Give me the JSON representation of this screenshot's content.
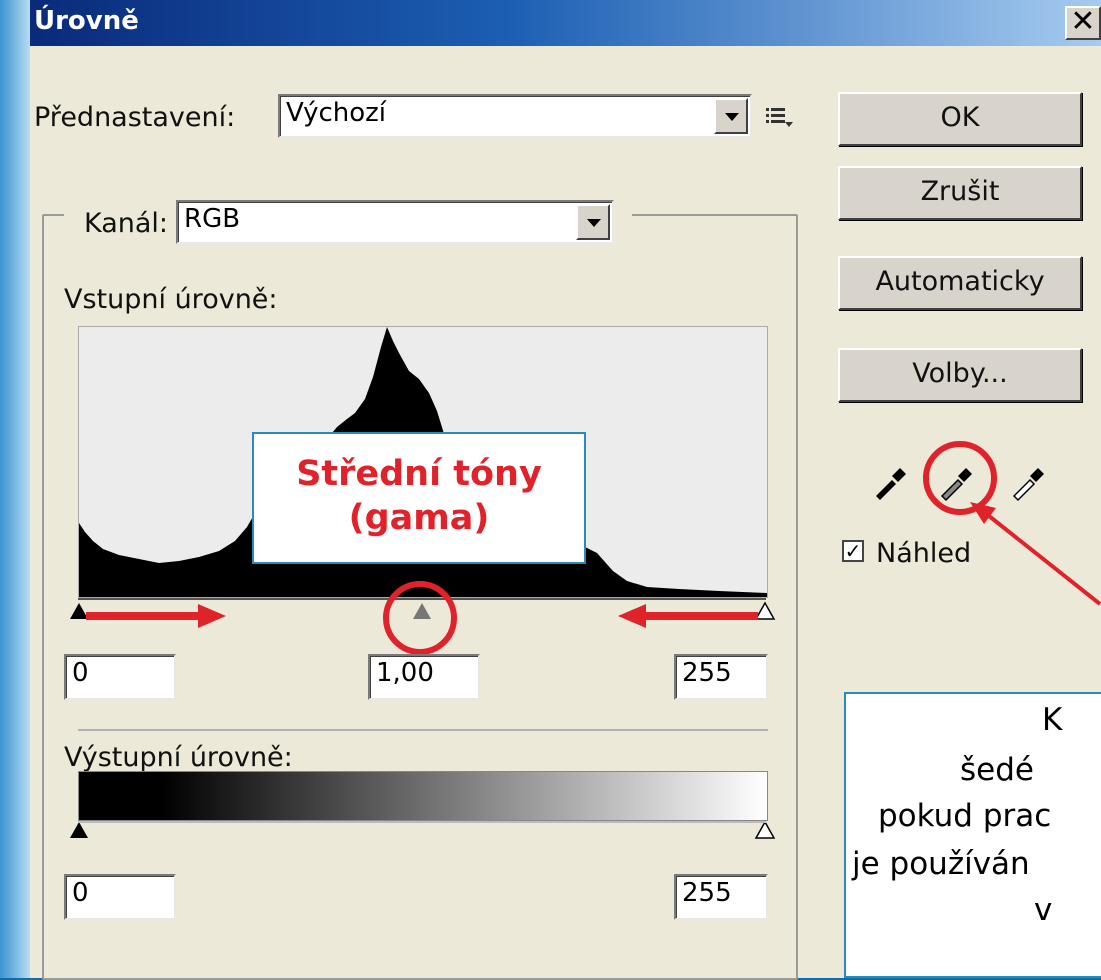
{
  "window": {
    "title": "Úrovně",
    "close_glyph": "✕"
  },
  "preset": {
    "label": "Přednastavení:",
    "value": "Výchozí",
    "menu_icon": "list-menu-icon"
  },
  "channel": {
    "label": "Kanál:",
    "value": "RGB"
  },
  "input_levels": {
    "label": "Vstupní úrovně:",
    "black": "0",
    "gamma": "1,00",
    "white": "255",
    "gamma_slider_fraction": 0.5
  },
  "output_levels": {
    "label": "Výstupní úrovně:",
    "black": "0",
    "white": "255"
  },
  "buttons": {
    "ok": "OK",
    "cancel": "Zrušit",
    "auto": "Automaticky",
    "options": "Volby..."
  },
  "eyedroppers": [
    "black-eyedropper-icon",
    "gray-eyedropper-icon",
    "white-eyedropper-icon"
  ],
  "preview": {
    "label": "Náhled",
    "checked": true
  },
  "annotation_midtones": {
    "line1": "Střední tóny",
    "line2": "(gama)"
  },
  "annotation_eyedropper": {
    "lines": [
      "K",
      "šedé",
      "pokud prac",
      "je používán",
      "v"
    ]
  },
  "colors": {
    "accent_red": "#e0222a",
    "annotation_border": "#2a8bb8",
    "dialog_bg": "#ece9d8"
  }
}
